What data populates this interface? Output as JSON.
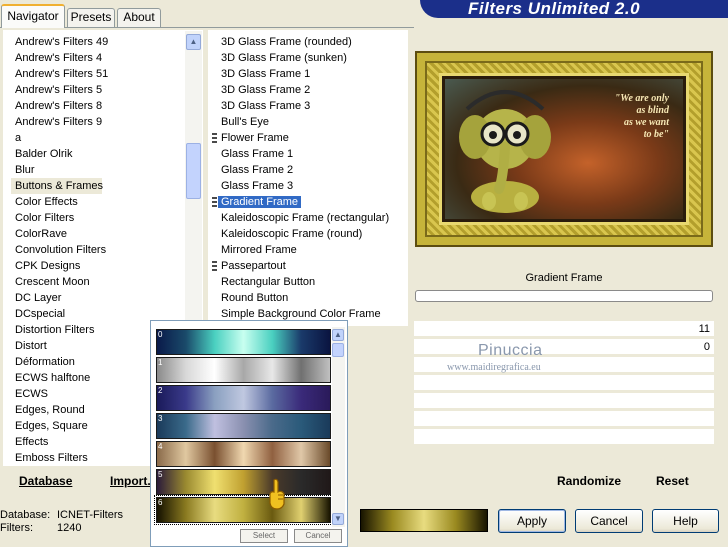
{
  "tabs": [
    {
      "label": "Navigator"
    },
    {
      "label": "Presets"
    },
    {
      "label": "About"
    }
  ],
  "banner": {
    "title": "Filters Unlimited 2.0"
  },
  "categories": {
    "selected_index": 10,
    "items": [
      "Andrew's Filters 49",
      "Andrew's Filters 4",
      "Andrew's Filters 51",
      "Andrew's Filters 5",
      "Andrew's Filters 8",
      "Andrew's Filters 9",
      "a",
      "Balder Olrik",
      "Blur",
      "Buttons & Frames",
      "Color Effects",
      "Color Filters",
      "ColorRave",
      "Convolution Filters",
      "CPK Designs",
      "Crescent Moon",
      "DC Layer",
      "DCspecial",
      "Distortion Filters",
      "Distort",
      "Déformation",
      "ECWS halftone",
      "ECWS",
      "Edges, Round",
      "Edges, Square",
      "Effects",
      "Emboss Filters"
    ]
  },
  "filters": {
    "items": [
      {
        "name": "3D Glass Frame (rounded)",
        "marker": false
      },
      {
        "name": "3D Glass Frame (sunken)",
        "marker": false
      },
      {
        "name": "3D Glass Frame 1",
        "marker": false
      },
      {
        "name": "3D Glass Frame 2",
        "marker": false
      },
      {
        "name": "3D Glass Frame 3",
        "marker": false
      },
      {
        "name": "Bull's Eye",
        "marker": false
      },
      {
        "name": "Flower Frame",
        "marker": true
      },
      {
        "name": "Glass Frame 1",
        "marker": false
      },
      {
        "name": "Glass Frame 2",
        "marker": false
      },
      {
        "name": "Glass Frame 3",
        "marker": false
      },
      {
        "name": "Gradient Frame",
        "marker": true,
        "selected": true
      },
      {
        "name": "Kaleidoscopic Frame (rectangular)",
        "marker": false
      },
      {
        "name": "Kaleidoscopic Frame (round)",
        "marker": false
      },
      {
        "name": "Mirrored Frame",
        "marker": false
      },
      {
        "name": "Passepartout",
        "marker": true
      },
      {
        "name": "Rectangular Button",
        "marker": false
      },
      {
        "name": "Round Button",
        "marker": false
      },
      {
        "name": "Simple Background Color Frame",
        "marker": false
      }
    ]
  },
  "preview": {
    "quote": "\"We are only\nas blind\nas we want\nto be\""
  },
  "current_filter": {
    "name": "Gradient Frame",
    "progress": 0
  },
  "params": [
    {
      "value": "11"
    },
    {
      "value": "0"
    },
    {
      "value": ""
    },
    {
      "value": ""
    },
    {
      "value": ""
    },
    {
      "value": ""
    },
    {
      "value": ""
    }
  ],
  "watermark": {
    "line1": "Pinuccia",
    "line2": "www.maidiregrafica.eu"
  },
  "bottom": {
    "database_link": "Database",
    "import_link": "Import...",
    "randomize_link": "Randomize",
    "reset_link": "Reset"
  },
  "status": {
    "database_label": "Database:",
    "database_value": "ICNET-Filters",
    "filters_label": "Filters:",
    "filters_value": "1240"
  },
  "buttons": {
    "apply": "Apply",
    "cancel": "Cancel",
    "help": "Help"
  },
  "gradient_picker": {
    "rows": [
      {
        "num": "0",
        "colors": "#0a1a4a,#1a4a6a,#4ad0c0,#c8fff0,#4ad0c0,#1a3a6a,#0a1440"
      },
      {
        "num": "1",
        "colors": "#8a8a8a,#d8d8d8,#ffffff,#a8a8a8,#e8e8e8,#707070,#c0c0c0"
      },
      {
        "num": "2",
        "colors": "#1a1a5a,#3a3a8a,#8aa0c0,#c0c8e0,#5a6aa0,#3a2a7a,#2a1a5a"
      },
      {
        "num": "3",
        "colors": "#1a3a5a,#3a6a8a,#c0c0e0,#8a90b0,#4a6a8a,#2a5a7a,#1a3a5a"
      },
      {
        "num": "4",
        "colors": "#8a6a4a,#e0c8a0,#7a5030,#f0d8b0,#906040,#e0c8a8,#6a4a2a"
      },
      {
        "num": "5",
        "colors": "#2a1a3a,#9a8a30,#f0e070,#c0a030,#4a3a2a,#2a2a2a,#201818"
      },
      {
        "num": "6",
        "colors": "#141000,#8a7a20,#e8dc80,#c0b040,#6a5a10,#e0d070,#181400"
      }
    ],
    "select_button": "Select",
    "cancel_button": "Cancel",
    "selected_index": 6
  },
  "colors": {
    "accent": "#316ac5",
    "banner": "#1b2f8a",
    "tab_highlight": "#f0b030",
    "dialog_bg": "#ece9d8"
  }
}
